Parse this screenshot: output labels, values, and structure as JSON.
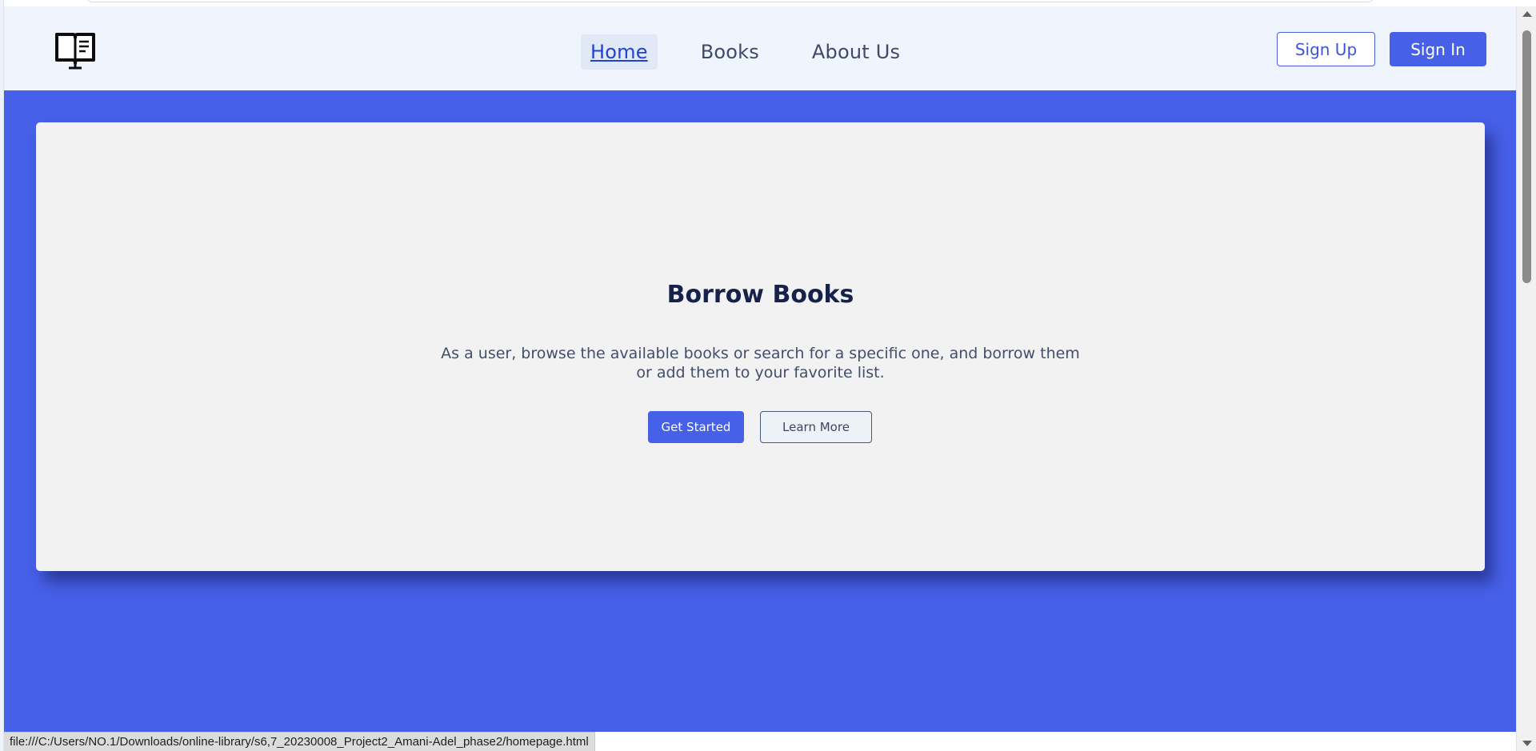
{
  "header": {
    "logo_icon": "open-book-icon",
    "nav": {
      "home": "Home",
      "books": "Books",
      "about": "About Us"
    },
    "sign_up": "Sign Up",
    "sign_in": "Sign In"
  },
  "hero": {
    "title": "Borrow Books",
    "description": "As a user, browse the available books or search for a specific one, and borrow them or add them to your favorite list.",
    "get_started": "Get Started",
    "learn_more": "Learn More"
  },
  "status_bar": {
    "url": "file:///C:/Users/NO.1/Downloads/online-library/s6,7_20230008_Project2_Amani-Adel_phase2/homepage.html"
  },
  "colors": {
    "primary": "#4660e8",
    "header_bg": "#eff4fd",
    "card_bg": "#f2f2f2",
    "title_text": "#17224b"
  }
}
